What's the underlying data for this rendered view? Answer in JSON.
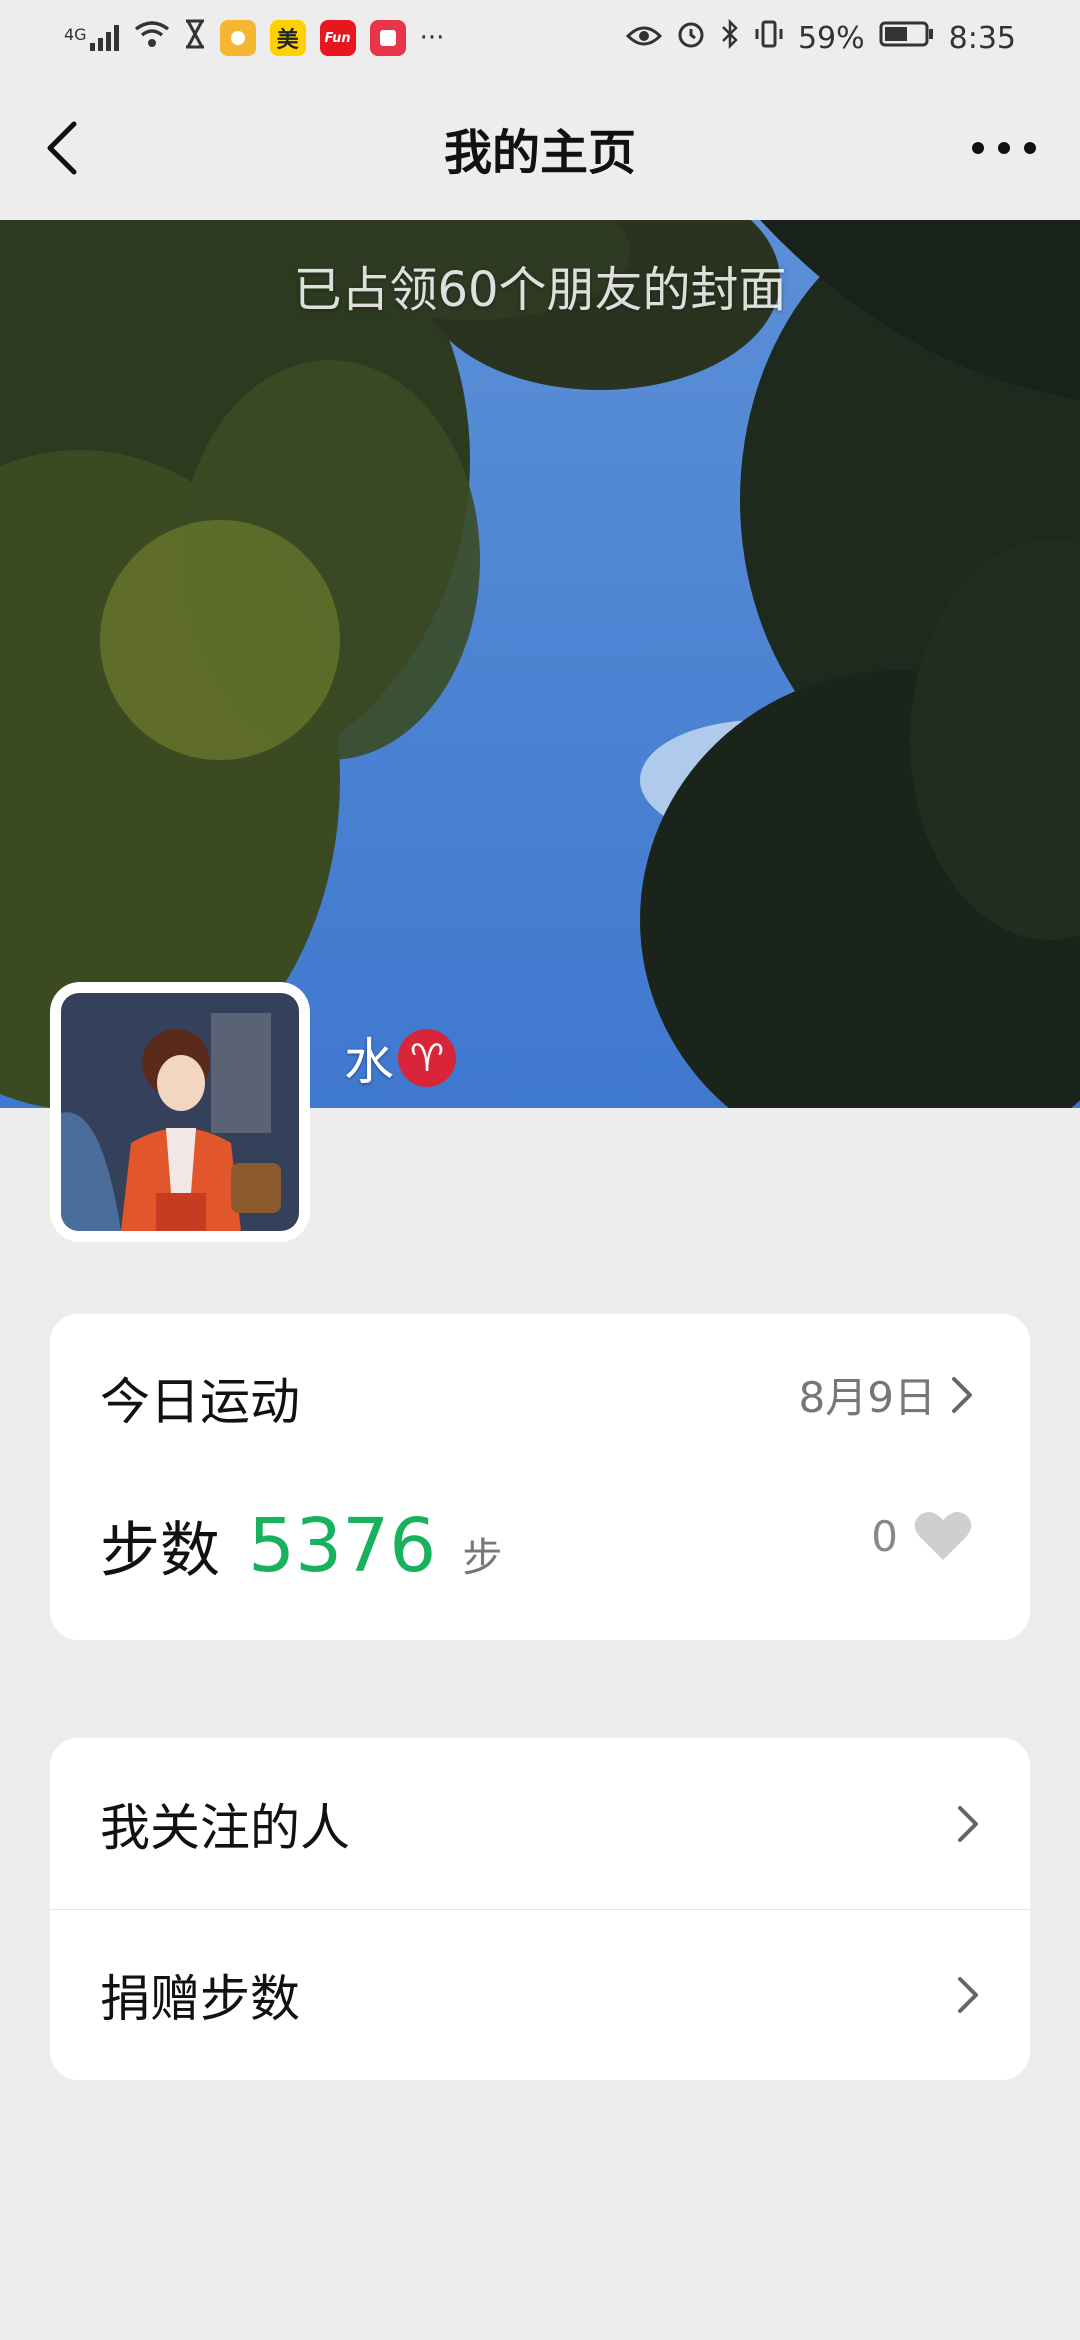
{
  "status_bar": {
    "signal": "4G",
    "app_icons": [
      "sun-app-icon",
      "meituan-app-icon",
      "fun-app-icon",
      "book-app-icon"
    ],
    "meituan_label": "美",
    "fun_label": "Fun",
    "more": "···",
    "battery": "59%",
    "time": "8:35"
  },
  "nav": {
    "title": "我的主页"
  },
  "cover": {
    "caption": "已占领60个朋友的封面"
  },
  "profile": {
    "nickname": "水",
    "zodiac_symbol": "♈"
  },
  "activity": {
    "header": "今日运动",
    "date": "8月9日",
    "steps_label": "步数",
    "steps_value": "5376",
    "steps_unit": "步",
    "likes": "0"
  },
  "list": {
    "items": [
      {
        "label": "我关注的人"
      },
      {
        "label": "捐赠步数"
      }
    ]
  },
  "colors": {
    "accent_green": "#18b25f",
    "background": "#ededed"
  }
}
